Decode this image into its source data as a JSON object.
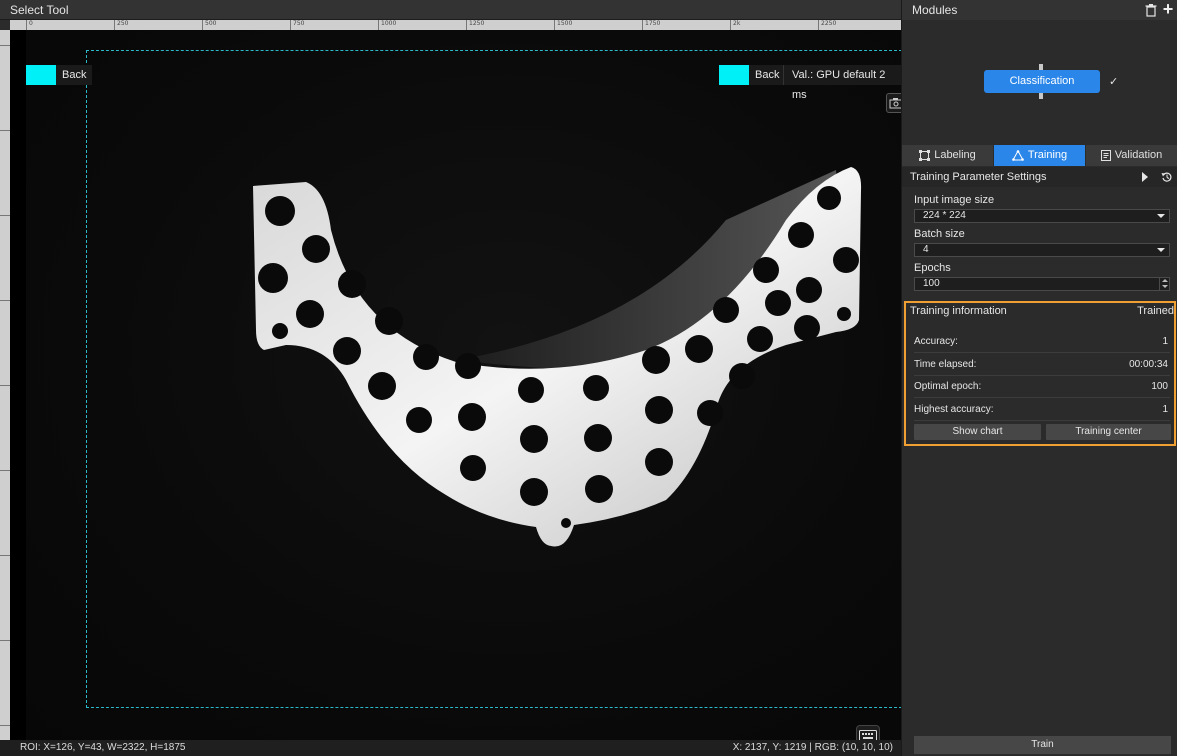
{
  "viewer": {
    "title": "Select Tool",
    "ruler_labels": [
      "0",
      "250",
      "500",
      "750",
      "1000",
      "1250",
      "1500",
      "1750",
      "2k",
      "2250"
    ],
    "back_left_label": "Back",
    "back_right_label": "Back",
    "val_label": "Val.:  GPU default 2 ms",
    "cam_icon": "camera-icon",
    "keyboard_icon": "keyboard-icon",
    "roi_color": "#2bb8c9",
    "swatch_color": "#00f0f8"
  },
  "status": {
    "roi": "ROI: X=126, Y=43, W=2322, H=1875",
    "xy": "X: 2137, Y: 1219 | RGB: (10, 10, 10)"
  },
  "panel": {
    "modules_title": "Modules",
    "module_node_label": "Classification",
    "module_accent": "#2a86e8",
    "tabs": [
      {
        "label": "Labeling",
        "icon": "labeling-icon"
      },
      {
        "label": "Training",
        "icon": "training-icon"
      },
      {
        "label": "Validation",
        "icon": "validation-icon"
      }
    ],
    "param_title": "Training Parameter Settings",
    "fields": {
      "input_size_label": "Input image size",
      "input_size_value": "224 * 224",
      "batch_label": "Batch size",
      "batch_value": "4",
      "epochs_label": "Epochs",
      "epochs_value": "100"
    },
    "training_info": {
      "title": "Training information",
      "status": "Trained",
      "highlight_color": "#f0a033",
      "rows": [
        {
          "label": "Accuracy:",
          "value": "1"
        },
        {
          "label": "Time elapsed:",
          "value": "00:00:34"
        },
        {
          "label": "Optimal epoch:",
          "value": "100"
        },
        {
          "label": "Highest accuracy:",
          "value": "1"
        }
      ],
      "show_chart_label": "Show chart",
      "training_center_label": "Training center"
    },
    "train_label": "Train"
  }
}
